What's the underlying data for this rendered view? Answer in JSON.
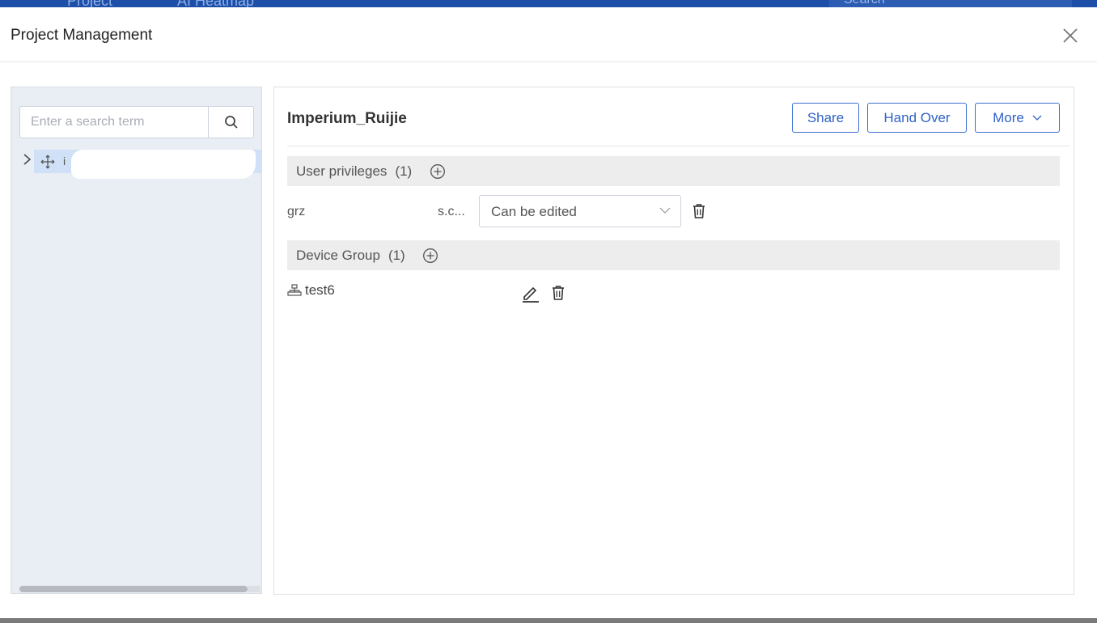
{
  "background": {
    "nav_items": [
      "Project",
      "AI Heatmap"
    ],
    "search_placeholder": "Search"
  },
  "modal": {
    "title": "Project Management",
    "close_icon": "close-icon"
  },
  "left_panel": {
    "search_placeholder": "Enter a search term",
    "search_icon": "search-icon",
    "tree": [
      {
        "label": "i",
        "expanded": false,
        "icon": "move-icon"
      }
    ]
  },
  "right_panel": {
    "project_name": "Imperium_Ruijie",
    "buttons": {
      "share": "Share",
      "hand_over": "Hand Over",
      "more": "More"
    },
    "user_privileges": {
      "label": "User privileges",
      "count": "(1)",
      "users": [
        {
          "email_start": "grz",
          "email_end": "s.c...",
          "permission": "Can be edited"
        }
      ]
    },
    "device_group": {
      "label": "Device Group",
      "count": "(1)",
      "groups": [
        {
          "name": "test6",
          "icon": "network-icon"
        }
      ]
    }
  },
  "colors": {
    "accent": "#3b6fd1",
    "topbar": "#1e4fa8",
    "left_panel_bg": "#e9edf4",
    "section_bg": "#ededed",
    "tree_selected": "#cfe0f7"
  }
}
